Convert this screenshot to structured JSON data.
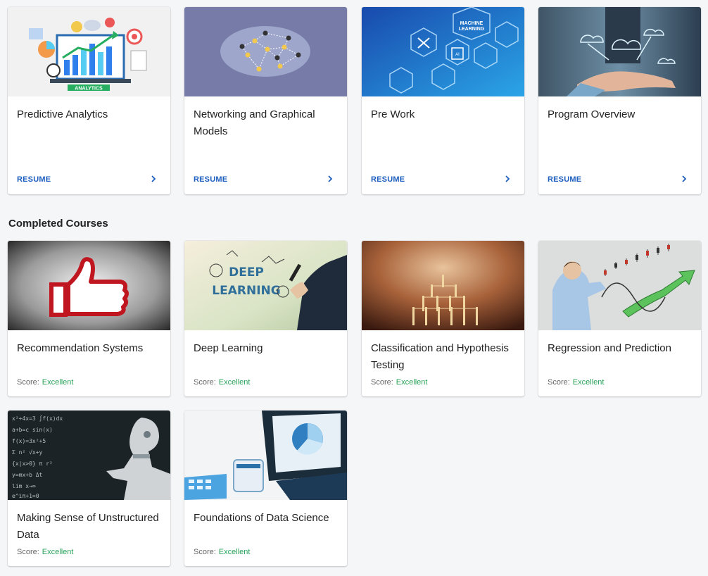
{
  "in_progress": [
    {
      "title": "Predictive Analytics",
      "action": "RESUME",
      "image": "analytics-dashboard-illustration"
    },
    {
      "title": "Networking and Graphical Models",
      "action": "RESUME",
      "image": "network-graph-illustration"
    },
    {
      "title": "Pre Work",
      "action": "RESUME",
      "image": "machine-learning-hexagon-image"
    },
    {
      "title": "Program Overview",
      "action": "RESUME",
      "image": "cloud-hand-image"
    }
  ],
  "completed_heading": "Completed Courses",
  "score_label": "Score:",
  "completed": [
    {
      "title": "Recommendation Systems",
      "score": "Excellent",
      "image": "thumbs-up-image"
    },
    {
      "title": "Deep Learning",
      "score": "Excellent",
      "image": "deep-learning-drawing-image"
    },
    {
      "title": "Classification and Hypothesis Testing",
      "score": "Excellent",
      "image": "wooden-pegs-tree-image"
    },
    {
      "title": "Regression and Prediction",
      "score": "Excellent",
      "image": "trend-chart-drawing-image"
    },
    {
      "title": "Making Sense of Unstructured Data",
      "score": "Excellent",
      "image": "robot-chalkboard-image"
    },
    {
      "title": "Foundations of Data Science",
      "score": "Excellent",
      "image": "laptop-chart-image"
    }
  ],
  "colors": {
    "accent": "#1f5fbf",
    "score_good": "#2aa35a",
    "background": "#f5f6f8"
  }
}
